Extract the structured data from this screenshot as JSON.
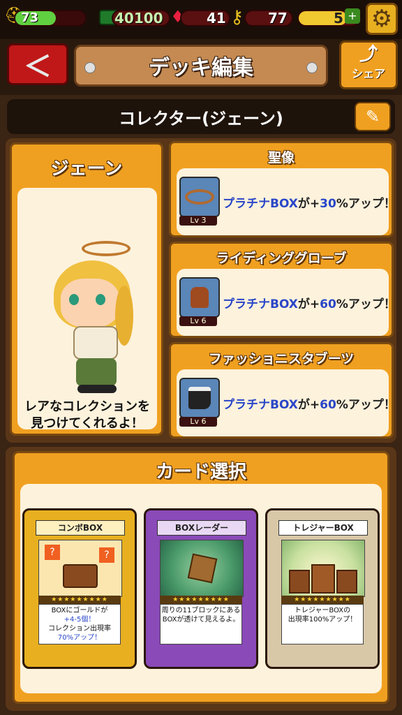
{
  "topbar": {
    "level": "73",
    "money": "40100",
    "gems": "41",
    "keys": "77",
    "stamina": "5"
  },
  "header": {
    "title": "デッキ編集",
    "share_label": "シェア"
  },
  "deck": {
    "name": "コレクター(ジェーン)"
  },
  "character": {
    "name": "ジェーン",
    "desc_line1": "レアなコレクションを",
    "desc_line2": "見つけてくれるよ！"
  },
  "items": [
    {
      "title": "聖像",
      "level": "Lv  3",
      "effect_pre": "プラチナBOX",
      "effect_mid": "が+",
      "effect_val": "30",
      "effect_post": "%アップ！",
      "icon": "halo-icon"
    },
    {
      "title": "ライディンググローブ",
      "level": "Lv  6",
      "effect_pre": "プラチナBOX",
      "effect_mid": "が+",
      "effect_val": "60",
      "effect_post": "%アップ！",
      "icon": "glove-icon"
    },
    {
      "title": "ファッショニスタブーツ",
      "level": "Lv  6",
      "effect_pre": "プラチナBOX",
      "effect_mid": "が+",
      "effect_val": "60",
      "effect_post": "%アップ！",
      "icon": "boot-icon"
    }
  ],
  "card_select": {
    "title": "カード選択",
    "cards": [
      {
        "name": "コンボBOX",
        "desc_l1": "BOXにゴールドが",
        "desc_l2": "+4-5個！",
        "desc_l3": "コレクション出現率",
        "desc_l4": "70%アップ！",
        "stars": "★★★★★★★★★"
      },
      {
        "name": "BOXレーダー",
        "desc_l1": "周りの11ブロックにある",
        "desc_l2": "BOXが透けて見えるよ。",
        "desc_l3": "",
        "desc_l4": "",
        "stars": "★★★★★★★★★"
      },
      {
        "name": "トレジャーBOX",
        "desc_l1": "トレジャーBOXの",
        "desc_l2": "出現率100%アップ！",
        "desc_l3": "",
        "desc_l4": "",
        "stars": "★★★★★★★★★"
      }
    ]
  },
  "colors": {
    "orange": "#f0a020",
    "cream": "#fdf2dc",
    "dark": "#3a2414",
    "blue_text": "#2a46c8"
  }
}
